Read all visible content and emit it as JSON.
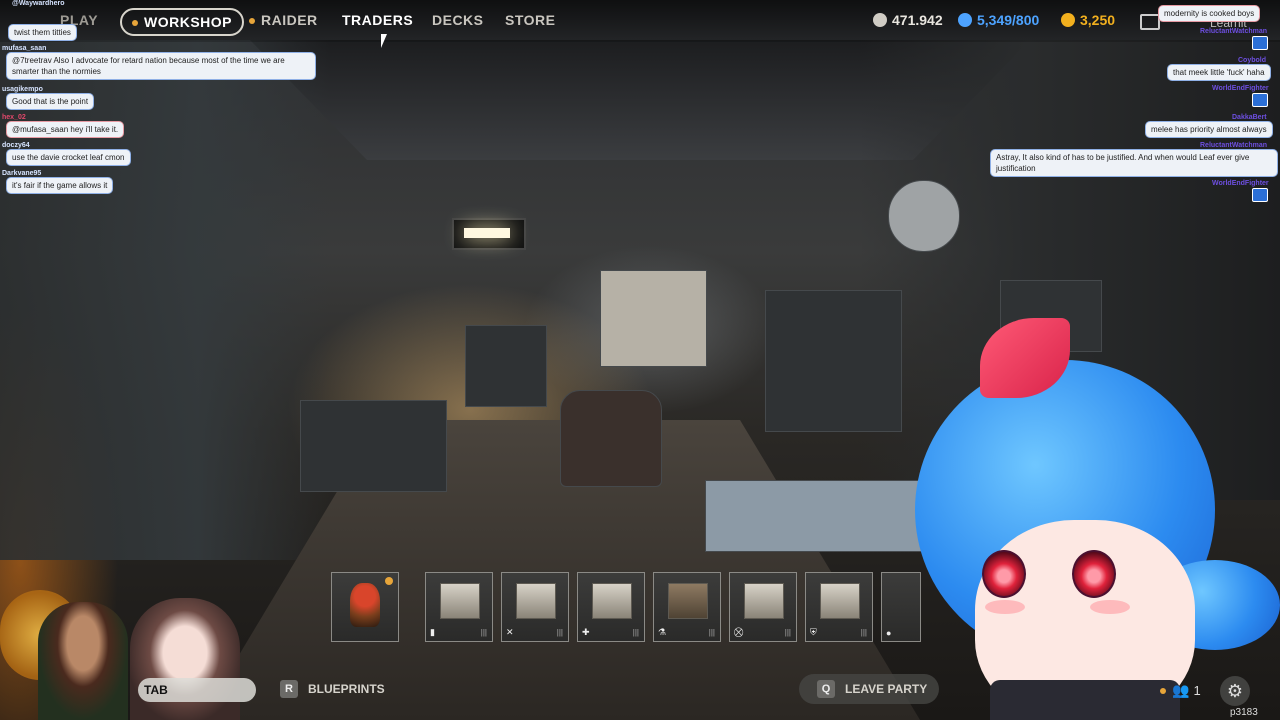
{
  "topnav": {
    "cut_label": "PLAY",
    "items": [
      "WORKSHOP",
      "RAIDER",
      "TRADERS",
      "DECKS",
      "STORE"
    ],
    "active": "WORKSHOP"
  },
  "currencies": {
    "coins": "471.942",
    "credits": "5,349/800",
    "raider_tokens": "3,250"
  },
  "chat_left": [
    {
      "name": "@Waywardhero",
      "msg": ""
    },
    {
      "name": "",
      "msg": "twist them titties"
    },
    {
      "name": "mufasa_saan",
      "msg": "@7treetrav Also I advocate for retard nation because most of the time we are smarter than the normies"
    },
    {
      "name": "usagikempo",
      "msg": "Good that is the point"
    },
    {
      "name": "hex_02",
      "msg": "@mufasa_saan hey i'll take it."
    },
    {
      "name": "doczy64",
      "msg": "use the davie crocket leaf cmon"
    },
    {
      "name": "Darkvane95",
      "msg": "it's fair if the game allows it"
    }
  ],
  "chat_right": [
    {
      "name": "",
      "msg": "modernity is cooked boys"
    },
    {
      "name": "ReluctantWatchman",
      "msg": ""
    },
    {
      "name": "Coybold",
      "msg": "that meek little 'fuck' haha"
    },
    {
      "name": "WorldEndFighter",
      "msg": ""
    },
    {
      "name": "DakkaBert",
      "msg": "melee has priority almost always"
    },
    {
      "name": "ReluctantWatchman",
      "msg": "Astray, It also kind of has to be justified. And when would Leaf ever give justification"
    },
    {
      "name": "WorldEndFighter",
      "msg": ""
    }
  ],
  "partial_labels": {
    "learnit": "Learnit"
  },
  "hotbar": {
    "slots": [
      {
        "name": "rooster",
        "glyph": ""
      },
      {
        "name": "workbench-1",
        "glyph": "▮"
      },
      {
        "name": "workbench-2",
        "glyph": "✕"
      },
      {
        "name": "workbench-3",
        "glyph": "✚"
      },
      {
        "name": "workbench-4",
        "glyph": "⚗"
      },
      {
        "name": "workbench-5",
        "glyph": "⛒"
      },
      {
        "name": "workbench-6",
        "glyph": "⛨"
      },
      {
        "name": "workbench-7",
        "glyph": "●"
      }
    ]
  },
  "bottom": {
    "tab_key": "TAB",
    "blueprints_key": "R",
    "blueprints_label": "BLUEPRINTS",
    "leave_key": "Q",
    "leave_label": "LEAVE PARTY",
    "party_count": "1",
    "watermark": "p3183"
  },
  "colors": {
    "accent": "#e7a53a",
    "chat_border": "#8fb0e6",
    "credits": "#4da3ff"
  }
}
